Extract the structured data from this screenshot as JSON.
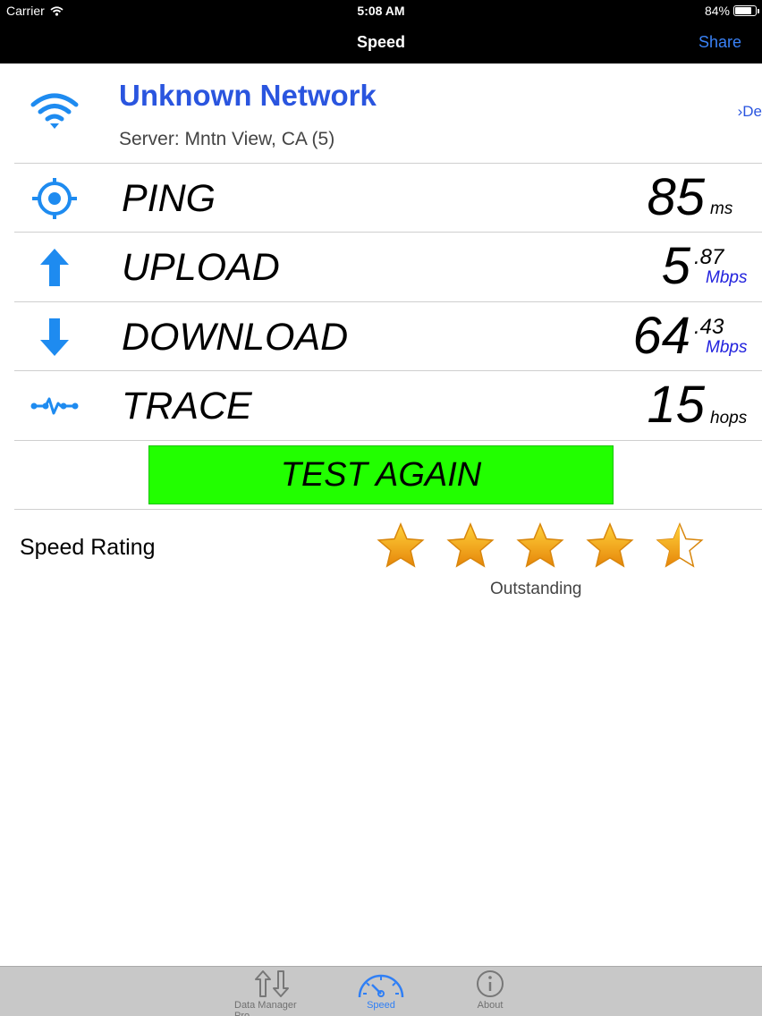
{
  "status": {
    "carrier": "Carrier",
    "time": "5:08 AM",
    "battery": "84%",
    "battery_level": 0.84
  },
  "nav": {
    "title": "Speed",
    "share_label": "Share"
  },
  "network": {
    "name": "Unknown Network",
    "server": "Server: Mntn View, CA (5)",
    "detail_label": "De"
  },
  "metrics": {
    "ping": {
      "label": "PING",
      "value": "85",
      "unit": "ms"
    },
    "upload": {
      "label": "UPLOAD",
      "value_int": "5",
      "value_frac": ".87",
      "unit": "Mbps"
    },
    "download": {
      "label": "DOWNLOAD",
      "value_int": "64",
      "value_frac": ".43",
      "unit": "Mbps"
    },
    "trace": {
      "label": "TRACE",
      "value": "15",
      "unit": "hops"
    }
  },
  "test_again_label": "TEST AGAIN",
  "rating": {
    "label": "Speed Rating",
    "stars": 4.5,
    "max_stars": 5,
    "text": "Outstanding"
  },
  "tabbar": {
    "tabs": [
      {
        "label": "Data Manager Pro",
        "icon": "arrows-updown-icon",
        "active": false
      },
      {
        "label": "Speed",
        "icon": "speedometer-icon",
        "active": true
      },
      {
        "label": "About",
        "icon": "info-icon",
        "active": false
      }
    ]
  },
  "colors": {
    "accent": "#2f7ff5",
    "network_name": "#2a55df",
    "test_button": "#22ff00",
    "star": "#f29a0e",
    "icon_blue": "#1e8bf0"
  }
}
